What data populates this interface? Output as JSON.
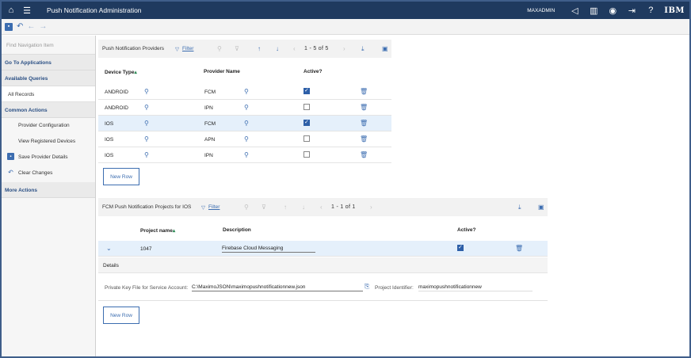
{
  "app": {
    "title": "Push Notification Administration",
    "user": "MAXADMIN",
    "brand": "IBM"
  },
  "nav": {
    "search_placeholder": "Find Navigation Item",
    "go_to_apps": "Go To Applications",
    "available_queries": "Available Queries",
    "all_records": "All Records",
    "common_actions": "Common Actions",
    "actions": [
      "Provider Configuration",
      "View Registered Devices",
      "Save Provider Details",
      "Clear Changes"
    ],
    "more_actions": "More Actions"
  },
  "providers": {
    "title": "Push Notification Providers",
    "filter": "Filter",
    "pager": "1 - 5 of 5",
    "columns": [
      "Device Type",
      "Provider Name",
      "Active?"
    ],
    "rows": [
      {
        "device": "ANDROID",
        "provider": "FCM",
        "active": true,
        "selected": false
      },
      {
        "device": "ANDROID",
        "provider": "IPN",
        "active": false,
        "selected": false
      },
      {
        "device": "IOS",
        "provider": "FCM",
        "active": true,
        "selected": true
      },
      {
        "device": "IOS",
        "provider": "APN",
        "active": false,
        "selected": false
      },
      {
        "device": "IOS",
        "provider": "IPN",
        "active": false,
        "selected": false
      }
    ],
    "new_row": "New Row"
  },
  "projects": {
    "title": "FCM Push Notification Projects for IOS",
    "filter": "Filter",
    "pager": "1 - 1 of 1",
    "columns": [
      "Project name",
      "Description",
      "Active?"
    ],
    "row": {
      "project": "1047",
      "description": "Firebase Cloud Messaging",
      "active": true
    },
    "details_label": "Details",
    "key_file_label": "Private Key File for Service Account:",
    "key_file_value": "C:\\MaximoJSON\\maximopushnotificationnew.json",
    "project_id_label": "Project Identifier:",
    "project_id_value": "maximopushnotificationnew",
    "new_row": "New Row"
  },
  "colors": {
    "topbar": "#1f3a5f",
    "accent": "#3c6db0",
    "selected_row": "#e5f0fb"
  }
}
